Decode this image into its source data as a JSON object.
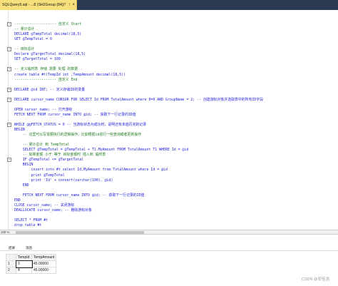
{
  "tab": {
    "label": "SQLQuery5.sql - ...8 (SH2Group (84))*",
    "pin": "↑",
    "close": "×"
  },
  "zoom": "100 %",
  "results_tabs": {
    "results": "结果",
    "messages": "消息"
  },
  "grid": {
    "columns": [
      "TempId",
      "TempAmount"
    ],
    "rows": [
      {
        "n": "1",
        "id": "3",
        "amount": "45.00000"
      },
      {
        "n": "2",
        "id": "4",
        "amount": "45.00000"
      }
    ]
  },
  "watermark": "CSDN @安佳浩",
  "code": [
    {
      "t": "-------------------- 自定义 Start",
      "c": "cm"
    },
    {
      "t": "-- 累计总计",
      "c": "cm"
    },
    {
      "t": "DECLARE @TempTotal decimal(18,5)",
      "c": "kw"
    },
    {
      "t": "SET @TempTotal = 0",
      "c": "kw"
    },
    {
      "t": "",
      "c": ""
    },
    {
      "t": "-- 目标总计",
      "c": "cm"
    },
    {
      "t": "Declare @TargetTotal decimal(18,5)",
      "c": "kw"
    },
    {
      "t": "SET @TargetTotal = 100",
      "c": "kw"
    },
    {
      "t": "",
      "c": ""
    },
    {
      "t": "-- 定义临时表 存储 需要 处理 的数据",
      "c": "cm"
    },
    {
      "t": "create table #t(TempId int ,TempAmount decimal(18,5))",
      "c": "kw"
    },
    {
      "t": "-------------------- 自定义 End",
      "c": "cm"
    },
    {
      "t": "",
      "c": ""
    },
    {
      "t": "DECLARE @id INT; -- 定义存储ID的变量",
      "c": "kw"
    },
    {
      "t": "",
      "c": ""
    },
    {
      "t": "DECLARE cursor_name CURSOR FOR SELECT Id FROM TotalAmount where 0=0 AND GroupName = 2; -- 创建游标对象并选取表中的所有ID字段",
      "c": "kw"
    },
    {
      "t": "",
      "c": ""
    },
    {
      "t": "OPEN cursor_name; -- 打开游标",
      "c": "kw"
    },
    {
      "t": "FETCH NEXT FROM cursor_name INTO @id; -- 获取下一行记录的ID值",
      "c": "kw"
    },
    {
      "t": "",
      "c": ""
    },
    {
      "t": "WHILE @@FETCH_STATUS = 0 -- 当游标状态为成功时，说明还有未遍历完的记录",
      "c": "kw"
    },
    {
      "t": "BEGIN",
      "c": "kw"
    },
    {
      "t": "    -- 这里可以写需要执行的逻辑操作，比如根据id进行一些查询或者更新操作",
      "c": "cm"
    },
    {
      "t": "",
      "c": ""
    },
    {
      "t": "    -- 累计总计 到 TempTotal",
      "c": "cm"
    },
    {
      "t": "    SELECT @TempTotal = @TempTotal + T1.MyAmount FROM TotalAmount T1 WHERE Id = @id",
      "c": "kw"
    },
    {
      "t": "    -- 如果金额 小于 等于 目标金额时 插入到 临时表",
      "c": "cm"
    },
    {
      "t": "    IF @TempTotal <= @TargetTotal",
      "c": "kw"
    },
    {
      "t": "    BEGIN",
      "c": "kw"
    },
    {
      "t": "        insert into #t select Id,MyAmount from TotalAmount where Id = @id",
      "c": "kw"
    },
    {
      "t": "        print @TempTotal",
      "c": "kw"
    },
    {
      "t": "        print 'Id' + convert(varchar(100), @id)",
      "c": "kw"
    },
    {
      "t": "    END",
      "c": "kw"
    },
    {
      "t": "",
      "c": ""
    },
    {
      "t": "    FETCH NEXT FROM cursor_name INTO @id; -- 获取下一行记录的ID值",
      "c": "kw"
    },
    {
      "t": "END",
      "c": "kw"
    },
    {
      "t": "CLOSE cursor_name; -- 关闭游标",
      "c": "kw"
    },
    {
      "t": "DEALLOCATE cursor_name; -- 删除游标对象",
      "c": "kw"
    },
    {
      "t": "",
      "c": ""
    },
    {
      "t": "SELECT * FROM #t",
      "c": "kw"
    },
    {
      "t": "drop table #t",
      "c": "kw"
    }
  ]
}
